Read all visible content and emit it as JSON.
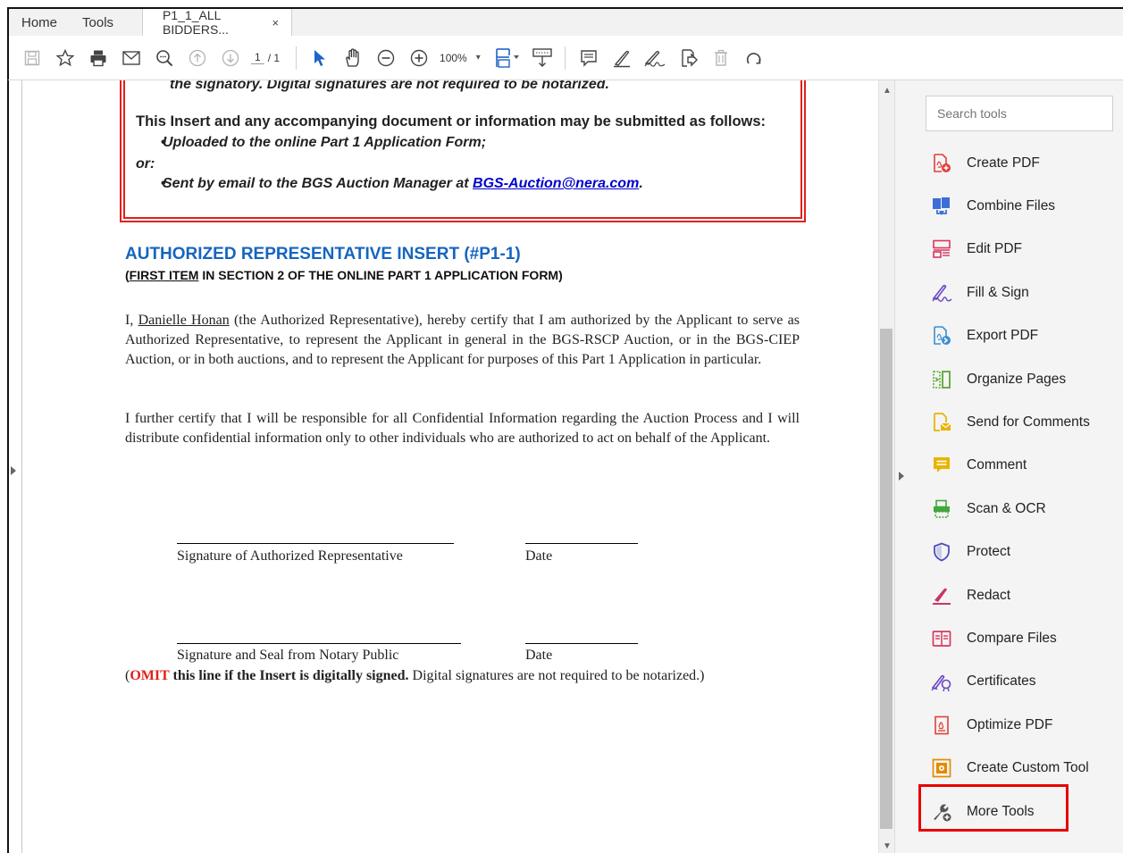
{
  "tabs": {
    "home": "Home",
    "tools": "Tools",
    "document": "P1_1_ALL BIDDERS...",
    "close": "×"
  },
  "toolbar": {
    "page_current": "1",
    "page_total": "/ 1",
    "zoom": "100%",
    "zoom_caret": "▾"
  },
  "document": {
    "top_cut_text": "the signatory.  Digital signatures are not required to be notarized.",
    "insert_line": "This Insert and any accompanying document or information may be submitted as follows:",
    "bullet1": "Uploaded to the online Part 1 Application Form;",
    "or_label": "or:",
    "bullet2_prefix": "Sent by email to the BGS Auction Manager at ",
    "bullet2_email": "BGS-Auction@nera.com",
    "bullet2_suffix": ".",
    "heading1": "AUTHORIZED REPRESENTATIVE INSERT (#P1-1)",
    "heading2_open": "(",
    "heading2_underlined": "FIRST ITEM",
    "heading2_rest": " IN SECTION 2 OF THE ONLINE PART 1 APPLICATION FORM)",
    "para1_prefix": "I, ",
    "para1_name": "Danielle Honan",
    "para1_rest": " (the Authorized Representative), hereby certify that I am authorized by the Applicant to serve as Authorized Representative, to represent the Applicant in general in the BGS-RSCP Auction, or in the BGS-CIEP Auction, or in both auctions, and to represent the Applicant for purposes of this Part 1 Application in particular.",
    "para2": "I further certify that I will be responsible for all Confidential Information regarding the Auction Process and I will distribute confidential information only to other individuals who are authorized to act on behalf of the Applicant.",
    "sig_label1": "Signature of Authorized Representative",
    "date_label1": "Date",
    "sig_label2": "Signature and Seal from Notary Public",
    "date_label2": "Date",
    "omit_open": "(",
    "omit_word": "OMIT",
    "omit_bold": " this line if the Insert is digitally signed.",
    "omit_rest": " Digital signatures are not required to be notarized.)"
  },
  "right_panel": {
    "search_placeholder": "Search tools",
    "tools": [
      {
        "label": "Create PDF",
        "icon": "create-pdf-icon",
        "color": "#e0403a"
      },
      {
        "label": "Combine Files",
        "icon": "combine-files-icon",
        "color": "#3b6fd6"
      },
      {
        "label": "Edit PDF",
        "icon": "edit-pdf-icon",
        "color": "#d9365e"
      },
      {
        "label": "Fill & Sign",
        "icon": "fill-sign-icon",
        "color": "#6b45c6"
      },
      {
        "label": "Export PDF",
        "icon": "export-pdf-icon",
        "color": "#3a8fd0"
      },
      {
        "label": "Organize Pages",
        "icon": "organize-pages-icon",
        "color": "#5ba830"
      },
      {
        "label": "Send for Comments",
        "icon": "send-comments-icon",
        "color": "#e9b300"
      },
      {
        "label": "Comment",
        "icon": "comment-icon",
        "color": "#e9b300"
      },
      {
        "label": "Scan & OCR",
        "icon": "scan-ocr-icon",
        "color": "#44a63e"
      },
      {
        "label": "Protect",
        "icon": "protect-icon",
        "color": "#4a4fc0"
      },
      {
        "label": "Redact",
        "icon": "redact-icon",
        "color": "#c8356b"
      },
      {
        "label": "Compare Files",
        "icon": "compare-files-icon",
        "color": "#d9365e"
      },
      {
        "label": "Certificates",
        "icon": "certificates-icon",
        "color": "#6b45c6"
      },
      {
        "label": "Optimize PDF",
        "icon": "optimize-pdf-icon",
        "color": "#e0403a"
      },
      {
        "label": "Create Custom Tool",
        "icon": "custom-tool-icon",
        "color": "#e68a00"
      },
      {
        "label": "More Tools",
        "icon": "more-tools-icon",
        "color": "#555555"
      }
    ]
  }
}
